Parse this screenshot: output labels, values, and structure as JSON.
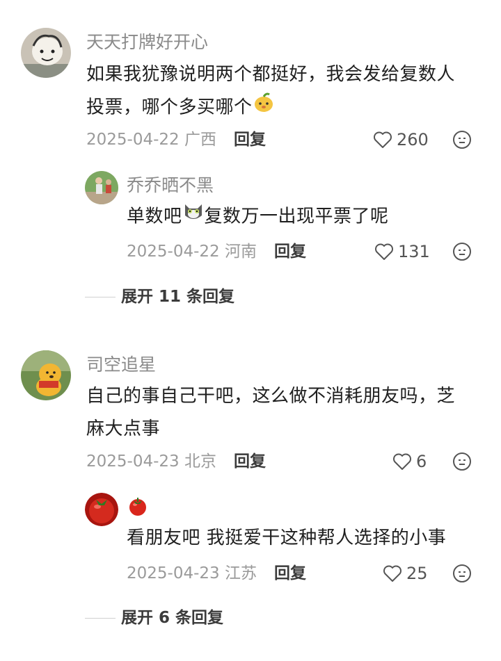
{
  "comments": [
    {
      "user": "天天打牌好开心",
      "text_a": "如果我犹豫说明两个都挺好，我会发给复数人",
      "text_b": "投票，哪个多买哪个",
      "date": "2025-04-22",
      "location": "广西",
      "reply_label": "回复",
      "likes": "260",
      "sub": {
        "user": "乔乔晒不黑",
        "text_a": "单数吧",
        "text_b": "复数万一出现平票了呢",
        "date": "2025-04-22",
        "location": "河南",
        "reply_label": "回复",
        "likes": "131"
      },
      "expand_label": "展开 11 条回复"
    },
    {
      "user": "司空追星",
      "text_a": "自己的事自己干吧，这么做不消耗朋友吗，芝",
      "text_b": "麻大点事",
      "date": "2025-04-23",
      "location": "北京",
      "reply_label": "回复",
      "likes": "6",
      "sub": {
        "user": "",
        "text_a": "看朋友吧 我挺爱干这种帮人选择的小事",
        "date": "2025-04-23",
        "location": "江苏",
        "reply_label": "回复",
        "likes": "25"
      },
      "expand_label": "展开 6 条回复"
    }
  ],
  "colors": {
    "text": "#1f1f1f",
    "meta": "#9a9a9a",
    "name": "#8a8a8a"
  }
}
